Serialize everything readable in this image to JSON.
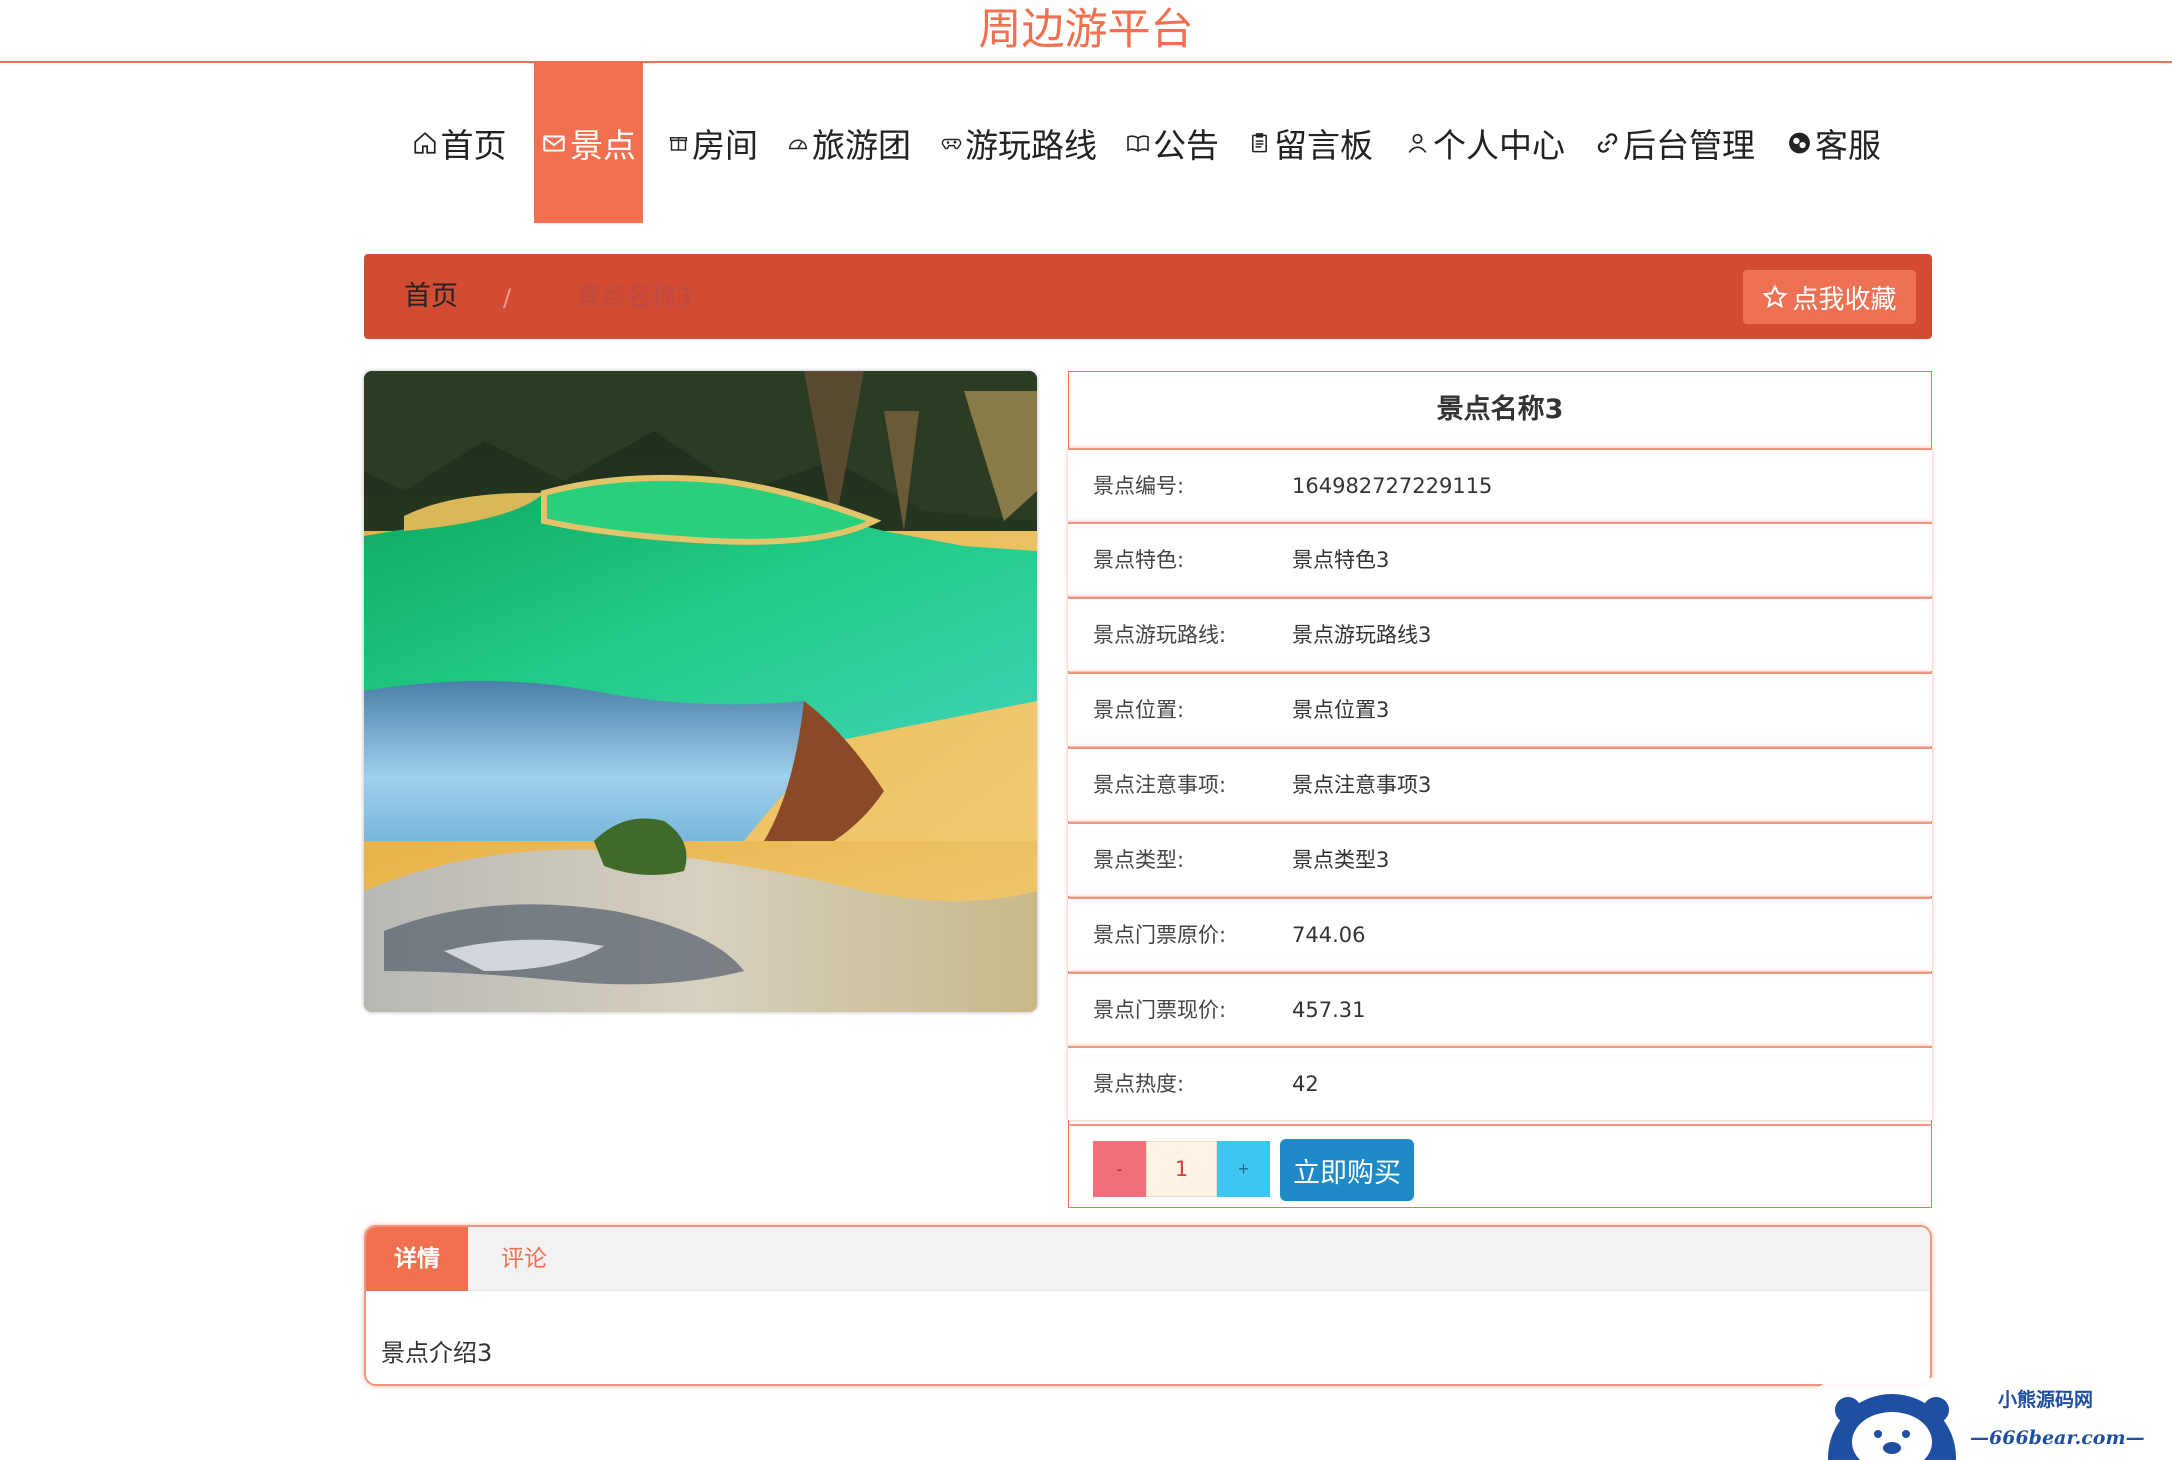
{
  "site": {
    "title": "周边游平台"
  },
  "nav": {
    "items": [
      {
        "label": "首页",
        "icon": "home-icon",
        "active": false
      },
      {
        "label": "景点",
        "icon": "mail-icon",
        "active": true
      },
      {
        "label": "房间",
        "icon": "gift-icon",
        "active": false
      },
      {
        "label": "旅游团",
        "icon": "dashboard-icon",
        "active": false
      },
      {
        "label": "游玩路线",
        "icon": "gamepad-icon",
        "active": false
      },
      {
        "label": "公告",
        "icon": "book-icon",
        "active": false
      },
      {
        "label": "留言板",
        "icon": "clipboard-icon",
        "active": false
      },
      {
        "label": "个人中心",
        "icon": "user-icon",
        "active": false
      },
      {
        "label": "后台管理",
        "icon": "link-icon",
        "active": false
      },
      {
        "label": "客服",
        "icon": "chat-icon",
        "active": false
      }
    ]
  },
  "breadcrumb": {
    "home": "首页",
    "separator": "/",
    "current": "景点名称3"
  },
  "favorite": {
    "label": "点我收藏",
    "icon": "star-icon"
  },
  "detail": {
    "title": "景点名称3",
    "rows": [
      {
        "label": "景点编号:",
        "value": "164982727229115"
      },
      {
        "label": "景点特色:",
        "value": "景点特色3"
      },
      {
        "label": "景点游玩路线:",
        "value": "景点游玩路线3"
      },
      {
        "label": "景点位置:",
        "value": "景点位置3"
      },
      {
        "label": "景点注意事项:",
        "value": "景点注意事项3"
      },
      {
        "label": "景点类型:",
        "value": "景点类型3"
      },
      {
        "label": "景点门票原价:",
        "value": "744.06"
      },
      {
        "label": "景点门票现价:",
        "value": "457.31"
      },
      {
        "label": "景点热度:",
        "value": "42"
      }
    ]
  },
  "purchase": {
    "minus": "-",
    "quantity": "1",
    "plus": "+",
    "buy_label": "立即购买"
  },
  "tabs": {
    "items": [
      {
        "label": "详情",
        "active": true
      },
      {
        "label": "评论",
        "active": false
      }
    ],
    "content": "景点介绍3"
  },
  "watermark": {
    "brand": "小熊源码网",
    "url": "—666bear.com—"
  },
  "colors": {
    "accent": "#f07050",
    "crumb": "#d24b33",
    "buy": "#1e8bc8",
    "minus": "#f0707c",
    "plus": "#3ec5f0"
  }
}
